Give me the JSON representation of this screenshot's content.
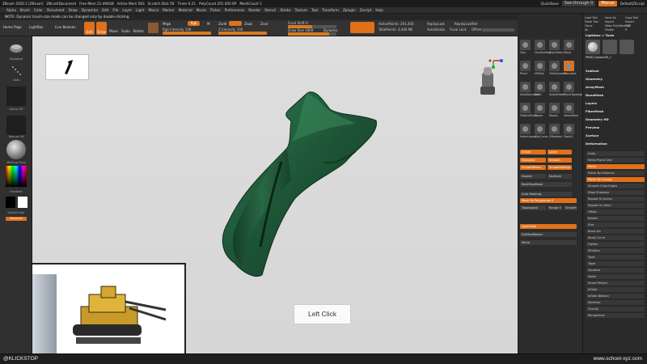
{
  "titlebar": {
    "segments": [
      "ZBrush 2020.1 [ZBrush]",
      "ZBrushDocument",
      "Free Mem 21.494GB",
      "Active Mem 583",
      "Scratch Disk 50",
      "Timer 0.21",
      "PolyCount 201.450 KP",
      "MeshCount 1"
    ],
    "quicksave": "QuickSave",
    "seethrough": "See-through 0",
    "menus": "Menus",
    "default_script": "DefaultZScript"
  },
  "menubar": {
    "items": [
      "Alpha",
      "Brush",
      "Color",
      "Document",
      "Draw",
      "Dynamics",
      "Edit",
      "File",
      "Layer",
      "Light",
      "Macro",
      "Marker",
      "Material",
      "Movie",
      "Picker",
      "Preferences",
      "Render",
      "Stencil",
      "Stroke",
      "Texture",
      "Tool",
      "Transform",
      "Zplugin",
      "Zscript",
      "Help"
    ]
  },
  "note": "NOTE: Dynamic brush-size mode can be changed only by double-clicking.",
  "toolbar": {
    "home_page": "Home Page",
    "lightbox": "LightBox",
    "live_boolean": "Live Boolean",
    "edit": "Edit",
    "draw": "Draw",
    "move": "Move",
    "scale": "Scale",
    "rotate": "Rotate",
    "mrgb": "Mrgb",
    "rgb": "Rgb",
    "m": "M",
    "zadd": "Zadd",
    "zsub": "Zsub",
    "zcut": "Zcut",
    "rgb_intensity": "Rgb Intensity 100",
    "z_intensity": "Z Intensity 100",
    "focal_shift": "Focal Shift 0",
    "draw_size": "Draw Size 1809",
    "dynamic": "Dynamic",
    "active_points": "ActivePoints: 201,450",
    "total_points": "TotalPoints: 4,444 Mil",
    "replay_last": "ReplayLast",
    "replay_last_rel": "ReplayLastRel",
    "auto_stroke": "AutoStroke",
    "focal_lock": "Focal Lock",
    "offset": "Offset"
  },
  "left_panel": {
    "items": [
      "Standard",
      "Dots",
      "Alpha Off",
      "Texture Off",
      "MatCap Gray",
      "Gradient",
      "SwitchColor",
      "Alternate"
    ]
  },
  "canvas": {
    "left_click_label": "Left Click"
  },
  "brush_column": {
    "brushes": [
      "Clay",
      "ClayBuildup",
      "ClayTubes",
      "Move",
      "Pinch",
      "hPolish",
      "TrimDynamic",
      "Standard",
      "DamStandard",
      "Inflat",
      "SnakeHook",
      "MoveTopological",
      "FlattenPinch",
      "Planar",
      "Morph",
      "SelectRect",
      "SelectLasso",
      "ClipCurve",
      "ZModeler",
      "Slash3"
    ],
    "buttons": [
      "Inflate",
      "Layer",
      "Standard",
      "Smooth",
      "SmoothPeaks",
      "SmoothValleys"
    ],
    "double": "Double",
    "no_back": "No Back",
    "back_face_mask": "BackFaceMask",
    "auto_masking": "Auto Masking",
    "mask_by_polygroups": "Mask By Polygroups 0",
    "topological": "Topological",
    "range": "Range 5",
    "smooth": "Smooth 5",
    "layer_hold": "LayerHold",
    "mirror": "Mirror",
    "sub_tool_master": "SubToolMaster"
  },
  "right_panel": {
    "header_rows": [
      "Load Tool",
      "Save As",
      "Copy Tool",
      "Paste Tool",
      "Import",
      "Export",
      "Clone",
      "Make PolyMesh3D",
      "GoZ",
      "All",
      "Visible",
      "R"
    ],
    "lightbox_tools": "Lightbox > Tools",
    "pm3d_label": "PM3D_Sphere3D_1",
    "sections": [
      "Subtool",
      "Geometry",
      "ArrayMesh",
      "NanoMesh",
      "Layers",
      "FiberMesh",
      "Geometry HD",
      "Preview",
      "Surface",
      "Deformation"
    ],
    "deform_rows": [
      "Unify",
      "Relax Plane Grid",
      "Polish",
      "Polish By Features",
      "Polish By Groups",
      "Smooth Crisp Edges",
      "Edge Shadows",
      "Repeat To Active",
      "Repeat To Other",
      "Offset",
      "Rotate",
      "Size",
      "Bend Arc",
      "Bend Curve",
      "Flatten",
      "SFlatten",
      "Twist",
      "Taper",
      "Squeeze",
      "Noise",
      "Smart ReSym",
      "Inflate",
      "Inflate Balloon",
      "Spherize",
      "Gravity",
      "Perspective"
    ]
  },
  "bottombar": {
    "left": "@KLICKSTOP",
    "right": "www.school-xyz.com"
  },
  "colors": {
    "accent": "#e0701a",
    "canvas": "#dcdcdc",
    "mesh": "#1f5a3a",
    "panel": "#2c2c2c"
  }
}
